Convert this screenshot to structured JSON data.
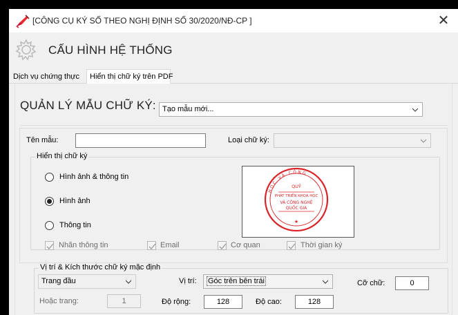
{
  "window": {
    "title": "[CÔNG CỤ KÝ SỐ THEO NGHỊ ĐỊNH SỐ 30/2020/NĐ-CP ]",
    "close_symbol": "✕",
    "header_title": "CẤU HÌNH HỆ THỐNG",
    "icons": {
      "app": "red-pen-icon",
      "header": "gear-icon"
    }
  },
  "tabs": [
    {
      "label": "Dịch vụ chứng thực",
      "selected": false
    },
    {
      "label": "Hiển thị chữ ký trên PDF",
      "selected": true
    }
  ],
  "template_manager": {
    "label": "QUẢN LÝ MẪU CHỮ KÝ:",
    "selected_value": "Tạo mẫu mới..."
  },
  "form": {
    "template_name_label": "Tên mẫu:",
    "template_name_value": "",
    "signature_type_label": "Loại chữ ký:",
    "signature_type_value": ""
  },
  "display_group": {
    "legend": "Hiển thị chữ ký",
    "options": [
      {
        "label": "Hình ảnh & thông tin",
        "checked": false
      },
      {
        "label": "Hình ảnh",
        "checked": true
      },
      {
        "label": "Thông tin",
        "checked": false
      }
    ],
    "checkboxes": [
      {
        "label": "Nhãn thông tin",
        "checked": true
      },
      {
        "label": "Email",
        "checked": true
      },
      {
        "label": "Cơ quan",
        "checked": true
      },
      {
        "label": "Thời gian ký",
        "checked": true
      }
    ],
    "stamp": {
      "top_text": "HỌC VÀ CÔNG",
      "bottom_text": "",
      "lines": [
        "QUỸ",
        "PHÁT TRIỂN KHOA HỌC",
        "VÀ CÔNG NGHỆ",
        "QUỐC GIA"
      ],
      "color": "#d9252a"
    }
  },
  "position_group": {
    "legend": "Vị trí  & Kích thước chữ ký mặc định",
    "page_select": "Trang đầu",
    "position_label": "Vị trí:",
    "position_value": "Góc trên bên trái",
    "font_size_label": "Cỡ chữ:",
    "font_size_value": "0",
    "or_page_label": "Hoặc trang:",
    "or_page_value": "1",
    "width_label": "Độ rộng:",
    "width_value": "128",
    "height_label": "Độ cao:",
    "height_value": "128"
  }
}
